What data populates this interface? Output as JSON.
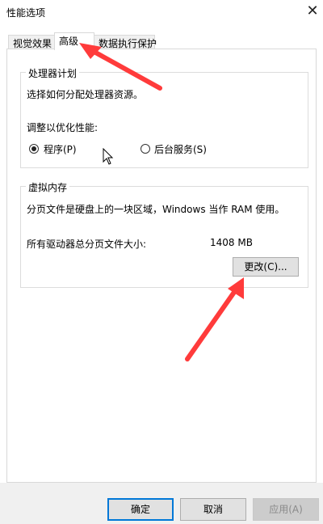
{
  "window": {
    "title": "性能选项",
    "close_icon": "close-icon"
  },
  "tabs": [
    {
      "label": "视觉效果",
      "active": false
    },
    {
      "label": "高级",
      "active": true
    },
    {
      "label": "数据执行保护",
      "active": false
    }
  ],
  "processor": {
    "legend": "处理器计划",
    "description": "选择如何分配处理器资源。",
    "adjust_label": "调整以优化性能:",
    "options": [
      {
        "label": "程序(P)",
        "checked": true
      },
      {
        "label": "后台服务(S)",
        "checked": false
      }
    ]
  },
  "virtual_memory": {
    "legend": "虚拟内存",
    "description": "分页文件是硬盘上的一块区域，Windows 当作 RAM 使用。",
    "total_label": "所有驱动器总分页文件大小:",
    "total_value": "1408 MB",
    "change_button": "更改(C)..."
  },
  "footer": {
    "ok": "确定",
    "cancel": "取消",
    "apply": "应用(A)"
  },
  "annotations": {
    "arrow_color": "#ff3b3b"
  }
}
